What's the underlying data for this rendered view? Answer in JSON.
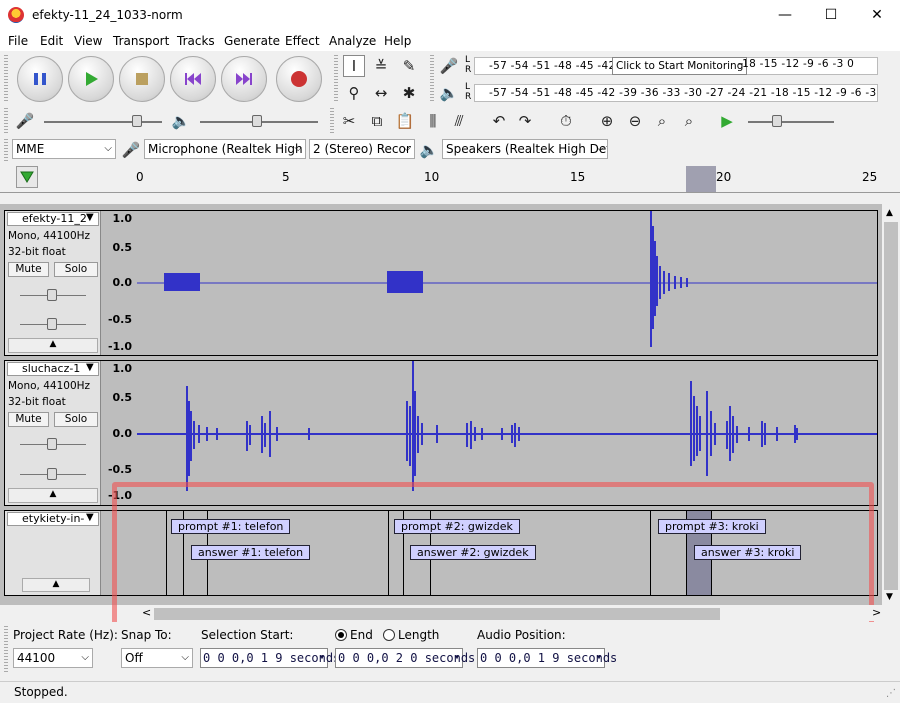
{
  "window": {
    "title": "efekty-11_24_1033-norm",
    "minimize": "—",
    "maximize": "☐",
    "close": "✕"
  },
  "menu": [
    "File",
    "Edit",
    "View",
    "Transport",
    "Tracks",
    "Generate",
    "Effect",
    "Analyze",
    "Help"
  ],
  "meter": {
    "record_scale": "-57 -54 -51 -48 -45 -42 -3",
    "record_scale_right": "-18 -15 -12 -9 -6 -3 0",
    "monitor_tip": "Click to Start Monitoring",
    "play_scale": "-57 -54 -51 -48 -45 -42 -39 -36 -33 -30 -27 -24 -21 -18 -15 -12 -9 -6 -3 0",
    "L": "L",
    "R": "R"
  },
  "devices": {
    "host": "MME",
    "mic": "Microphone (Realtek High",
    "channels": "2 (Stereo) Recor",
    "speakers": "Speakers (Realtek High Def"
  },
  "ruler": {
    "ticks": [
      "0",
      "5",
      "10",
      "15",
      "20",
      "25"
    ]
  },
  "tracks": [
    {
      "name": "efekty-11_2",
      "info1": "Mono, 44100Hz",
      "info2": "32-bit float",
      "mute": "Mute",
      "solo": "Solo",
      "y": [
        "1.0",
        "0.5",
        "0.0",
        "-0.5",
        "-1.0"
      ]
    },
    {
      "name": "sluchacz-1",
      "info1": "Mono, 44100Hz",
      "info2": "32-bit float",
      "mute": "Mute",
      "solo": "Solo",
      "y": [
        "1.0",
        "0.5",
        "0.0",
        "-0.5",
        "-1.0"
      ]
    }
  ],
  "label_track": {
    "name": "etykiety-in-",
    "labels": [
      "prompt #1: telefon",
      "answer #1: telefon",
      "prompt #2: gwizdek",
      "answer #2: gwizdek",
      "prompt #3: kroki",
      "answer #3: kroki"
    ]
  },
  "selection": {
    "project_rate_label": "Project Rate (Hz):",
    "project_rate": "44100",
    "snap_label": "Snap To:",
    "snap": "Off",
    "sel_start_label": "Selection Start:",
    "end_label": "End",
    "length_label": "Length",
    "audio_pos_label": "Audio Position:",
    "start": "0 0 0,0 1 9 seconds",
    "end": "0 0 0,0 2 0 seconds",
    "pos": "0 0 0,0 1 9 seconds"
  },
  "status": "Stopped.",
  "colors": {
    "wave": "#3232c8",
    "label_bg": "#d0d0ff",
    "highlight": "#f05050"
  }
}
